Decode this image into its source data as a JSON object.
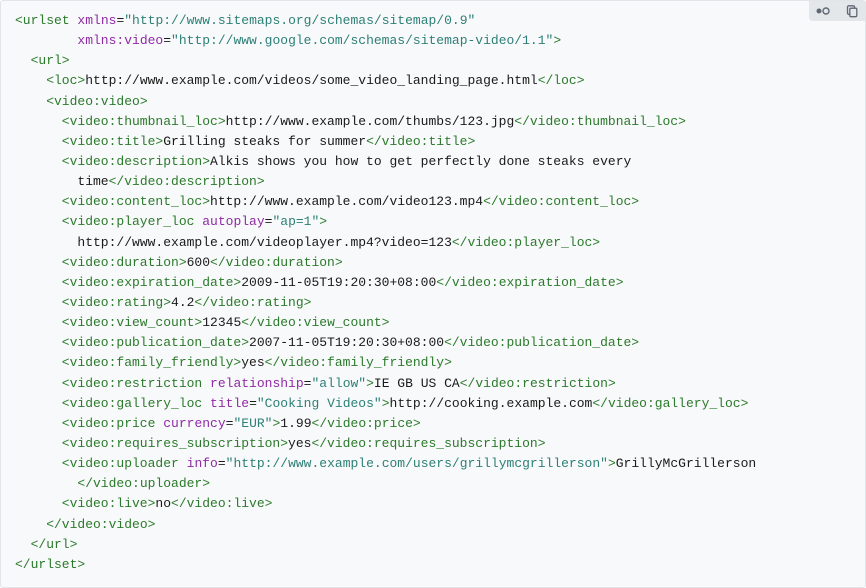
{
  "code": {
    "l1a": "<urlset",
    "l1_attr": "xmlns",
    "l1_val": "\"http://www.sitemaps.org/schemas/sitemap/0.9\"",
    "l2_attr": "xmlns:video",
    "l2_val": "\"http://www.google.com/schemas/sitemap-video/1.1\"",
    "l2_end": ">",
    "url_open": "<url>",
    "url_close": "</url>",
    "urlset_close": "</urlset>",
    "loc_open": "<loc>",
    "loc_text": "http://www.example.com/videos/some_video_landing_page.html",
    "loc_close": "</loc>",
    "video_open": "<video:video>",
    "video_close": "</video:video>",
    "thumb_open": "<video:thumbnail_loc>",
    "thumb_text": "http://www.example.com/thumbs/123.jpg",
    "thumb_close": "</video:thumbnail_loc>",
    "title_open": "<video:title>",
    "title_text": "Grilling steaks for summer",
    "title_close": "</video:title>",
    "desc_open": "<video:description>",
    "desc_text1": "Alkis shows you how to get perfectly done steaks every",
    "desc_text2": "time",
    "desc_close": "</video:description>",
    "content_open": "<video:content_loc>",
    "content_text": "http://www.example.com/video123.mp4",
    "content_close": "</video:content_loc>",
    "player_open": "<video:player_loc",
    "player_attr": "autoplay",
    "player_val": "\"ap=1\"",
    "player_open_end": ">",
    "player_text": "http://www.example.com/videoplayer.mp4?video=123",
    "player_close": "</video:player_loc>",
    "dur_open": "<video:duration>",
    "dur_text": "600",
    "dur_close": "</video:duration>",
    "exp_open": "<video:expiration_date>",
    "exp_text": "2009-11-05T19:20:30+08:00",
    "exp_close": "</video:expiration_date>",
    "rat_open": "<video:rating>",
    "rat_text": "4.2",
    "rat_close": "</video:rating>",
    "vc_open": "<video:view_count>",
    "vc_text": "12345",
    "vc_close": "</video:view_count>",
    "pub_open": "<video:publication_date>",
    "pub_text": "2007-11-05T19:20:30+08:00",
    "pub_close": "</video:publication_date>",
    "fam_open": "<video:family_friendly>",
    "fam_text": "yes",
    "fam_close": "</video:family_friendly>",
    "rest_open": "<video:restriction",
    "rest_attr": "relationship",
    "rest_val": "\"allow\"",
    "rest_open_end": ">",
    "rest_text": "IE GB US CA",
    "rest_close": "</video:restriction>",
    "gal_open": "<video:gallery_loc",
    "gal_attr": "title",
    "gal_val": "\"Cooking Videos\"",
    "gal_open_end": ">",
    "gal_text": "http://cooking.example.com",
    "gal_close": "</video:gallery_loc>",
    "price_open": "<video:price",
    "price_attr": "currency",
    "price_val": "\"EUR\"",
    "price_open_end": ">",
    "price_text": "1.99",
    "price_close": "</video:price>",
    "sub_open": "<video:requires_subscription>",
    "sub_text": "yes",
    "sub_close": "</video:requires_subscription>",
    "up_open": "<video:uploader",
    "up_attr": "info",
    "up_val": "\"http://www.example.com/users/grillymcgrillerson\"",
    "up_open_end": ">",
    "up_text": "GrillyMcGrillerson",
    "up_close": "</video:uploader>",
    "live_open": "<video:live>",
    "live_text": "no",
    "live_close": "</video:live>"
  },
  "toolbar": {
    "toggle": "toggle",
    "copy": "copy"
  }
}
